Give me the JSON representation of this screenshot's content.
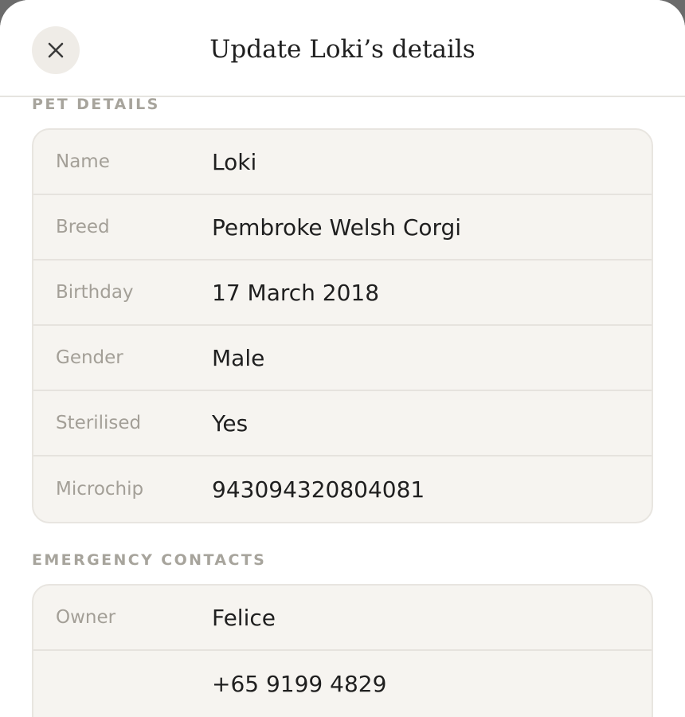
{
  "header": {
    "title": "Update Loki’s details",
    "close_icon": "close-icon"
  },
  "pet_details": {
    "label": "PET DETAILS",
    "rows": [
      {
        "label": "Name",
        "value": "Loki"
      },
      {
        "label": "Breed",
        "value": "Pembroke Welsh Corgi"
      },
      {
        "label": "Birthday",
        "value": "17 March 2018"
      },
      {
        "label": "Gender",
        "value": "Male"
      },
      {
        "label": "Sterilised",
        "value": "Yes"
      },
      {
        "label": "Microchip",
        "value": "943094320804081"
      }
    ]
  },
  "emergency_contacts": {
    "label": "EMERGENCY CONTACTS",
    "rows": [
      {
        "label": "Owner",
        "value": "Felice"
      },
      {
        "label": "",
        "value": "+65 9199 4829"
      }
    ]
  }
}
